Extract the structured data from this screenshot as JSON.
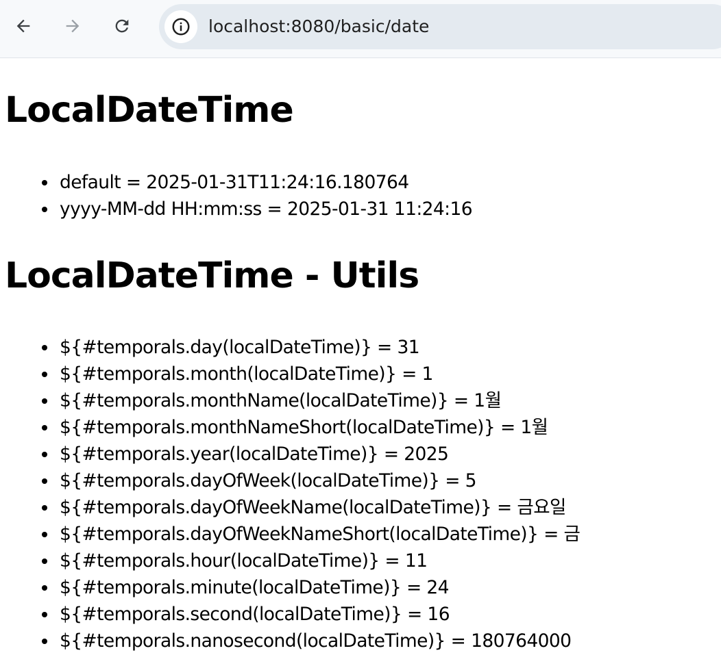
{
  "browser": {
    "url": "localhost:8080/basic/date"
  },
  "icons": {
    "back": "back-arrow-icon",
    "forward": "forward-arrow-icon",
    "reload": "reload-icon",
    "site_info": "info-icon"
  },
  "page": {
    "section1": {
      "title": "LocalDateTime",
      "items": [
        "default = 2025-01-31T11:24:16.180764",
        "yyyy-MM-dd HH:mm:ss = 2025-01-31 11:24:16"
      ]
    },
    "section2": {
      "title": "LocalDateTime - Utils",
      "items": [
        "${#temporals.day(localDateTime)} = 31",
        "${#temporals.month(localDateTime)} = 1",
        "${#temporals.monthName(localDateTime)} = 1월",
        "${#temporals.monthNameShort(localDateTime)} = 1월",
        "${#temporals.year(localDateTime)} = 2025",
        "${#temporals.dayOfWeek(localDateTime)} = 5",
        "${#temporals.dayOfWeekName(localDateTime)} = 금요일",
        "${#temporals.dayOfWeekNameShort(localDateTime)} = 금",
        "${#temporals.hour(localDateTime)} = 11",
        "${#temporals.minute(localDateTime)} = 24",
        "${#temporals.second(localDateTime)} = 16",
        "${#temporals.nanosecond(localDateTime)} = 180764000"
      ]
    }
  }
}
